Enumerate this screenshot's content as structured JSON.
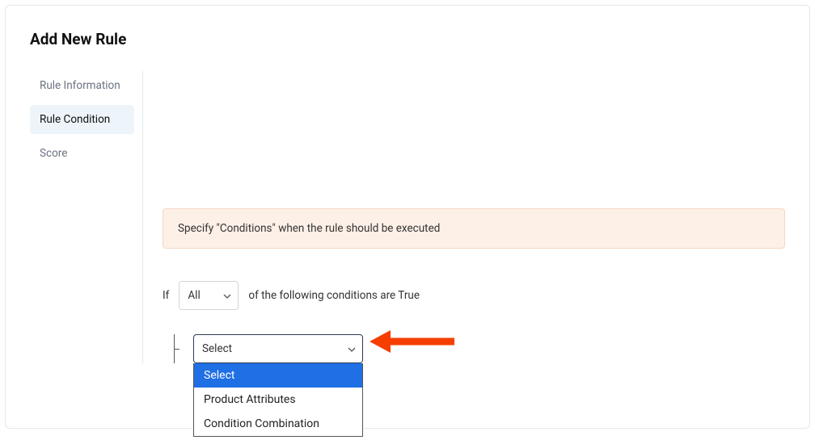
{
  "page": {
    "title": "Add New Rule"
  },
  "sidebar": {
    "items": [
      {
        "label": "Rule Information"
      },
      {
        "label": "Rule Condition"
      },
      {
        "label": "Score"
      }
    ]
  },
  "info_box": {
    "text": "Specify \"Conditions\" when the rule should be executed"
  },
  "condition": {
    "if_label": "If",
    "match_value": "All",
    "suffix": "of the following conditions are True"
  },
  "type_select": {
    "value": "Select",
    "options": [
      "Select",
      "Product Attributes",
      "Condition Combination"
    ]
  }
}
